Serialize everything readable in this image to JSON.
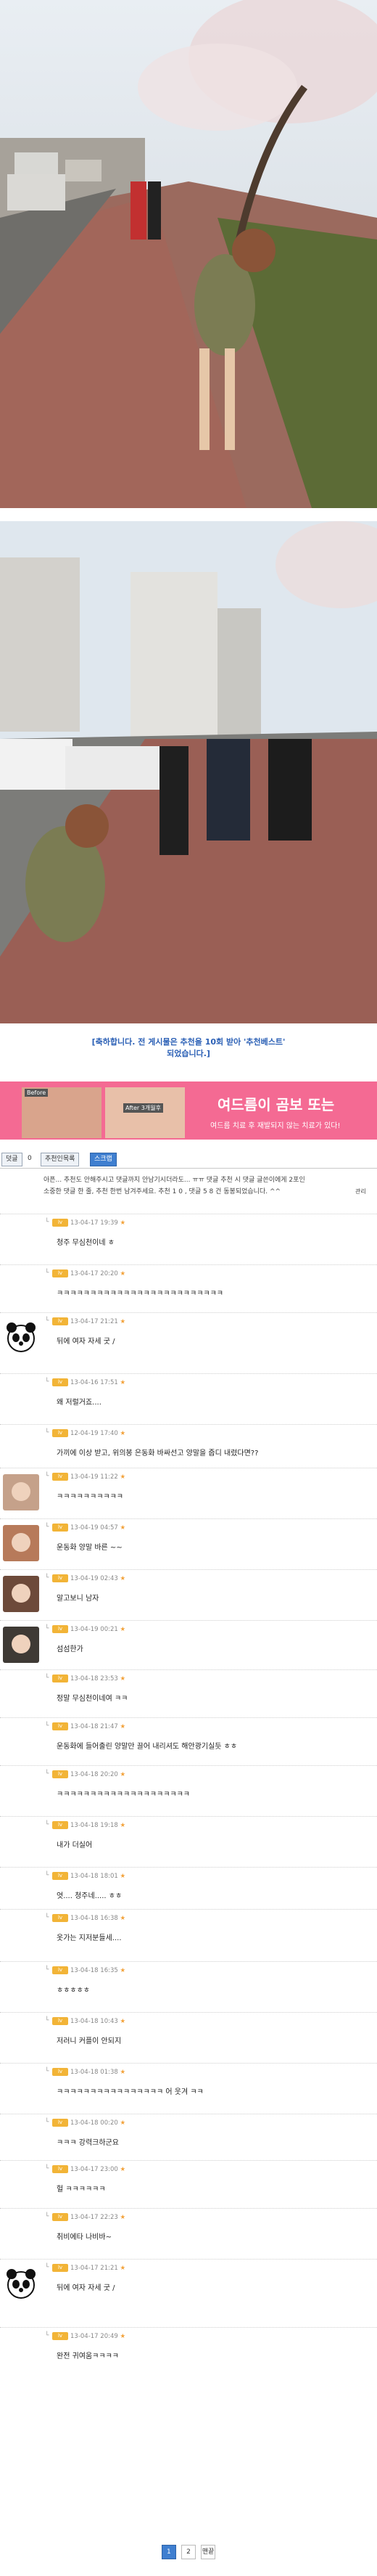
{
  "notice": {
    "line1": "[축하합니다. 전 게시물은 추천을 10회 받아 '추천베스트'",
    "line2": "되었습니다.]"
  },
  "ad": {
    "before_label": "Before",
    "after_label": "After 3개월후",
    "headline": "여드름이 곰보 또는",
    "subline": "여드름 치료 후 재발되지 않는 치료가 있다!"
  },
  "tabs": {
    "comment_label": "덧글",
    "comment_count": "0",
    "recommend_label": "추천인목록",
    "scrap_label": "스크랩"
  },
  "info": {
    "line1": "아픈... 추천도 안해주시고 댓글까지 안남기시더라도... ㅠㅠ 댓글 추천 시 댓글 글쓴이에게 2포인",
    "line2": "소중한 댓글 한 줄, 추천 한번 남겨주세요. 추천 1 0 , 댓글 5 8 건 동봉되었습니다. ^^",
    "extra": "관리"
  },
  "comments": [
    {
      "meta": "13-04-17 19:39",
      "text": "청주 무심천이네 ㅎ"
    },
    {
      "meta": "13-04-17 20:20",
      "text": "ㅋㅋㅋㅋㅋㅋㅋㅋㅋㅋㅋㅋㅋㅋㅋㅋㅋㅋㅋㅋㅋㅋㅋㅋㅋ"
    },
    {
      "meta": "13-04-17 21:21",
      "text": "뒤에 여자 자세 굿 /"
    },
    {
      "meta": "13-04-16 17:51",
      "text": "왜 저럴거죠...."
    },
    {
      "meta": "12-04-19 17:40",
      "text": "가끼에 이상 받고, 위의봉 은동화 바싸선고 양말을 줍디 내렸다면??"
    },
    {
      "meta": "13-04-19 11:22",
      "text": "ㅋㅋㅋㅋㅋㅋㅋㅋㅋㅋ"
    },
    {
      "meta": "13-04-19 04:57",
      "text": "운동화 양말 바른 ~~"
    },
    {
      "meta": "13-04-19 02:43",
      "text": "알고보니 남자"
    },
    {
      "meta": "13-04-19 00:21",
      "text": "섬섬한가"
    },
    {
      "meta": "13-04-18 23:53",
      "text": "정말 무심천이네여 ㅋㅋ"
    },
    {
      "meta": "13-04-18 21:47",
      "text": "운동화에 들어출린 양말만 끌어 내리셔도 해안광기실듯 ㅎㅎ"
    },
    {
      "meta": "13-04-18 20:20",
      "text": "ㅋㅋㅋㅋㅋㅋㅋㅋㅋㅋㅋㅋㅋㅋㅋㅋㅋㅋㅋㅋ"
    },
    {
      "meta": "13-04-18 19:18",
      "text": "내가 더실어"
    },
    {
      "meta": "13-04-18 18:01",
      "text": "엇.... 청주네..... ㅎㅎ"
    },
    {
      "meta": "13-04-18 16:38",
      "text": "옷가는 지저분들세...."
    },
    {
      "meta": "13-04-18 16:35",
      "text": "ㅎㅎㅎㅎㅎ"
    },
    {
      "meta": "13-04-18 10:43",
      "text": "저러니 커플이 안되지"
    },
    {
      "meta": "13-04-18 01:38",
      "text": "ㅋㅋㅋㅋㅋㅋㅋㅋㅋㅋㅋㅋㅋㅋㅋㅋ 어 웃겨 ㅋㅋ"
    },
    {
      "meta": "13-04-18 00:20",
      "text": "ㅋㅋㅋ 강력크하군요"
    },
    {
      "meta": "13-04-17 23:00",
      "text": "헐 ㅋㅋㅋㅋㅋㅋ"
    },
    {
      "meta": "13-04-17 22:23",
      "text": "취비에타 나비바~"
    },
    {
      "meta": "13-04-17 21:21",
      "text": "뒤에 여자 자세 굿 /"
    },
    {
      "meta": "13-04-17 20:49",
      "text": "완전 귀여움ㅋㅋㅋㅋ"
    }
  ],
  "pager": {
    "p1": "1",
    "p2": "2",
    "next": "맨끝"
  },
  "colors": {
    "accent": "#3f7fd0",
    "notice": "#2a5fb5",
    "highlight": "#e0362c",
    "level": "#f2b437"
  }
}
